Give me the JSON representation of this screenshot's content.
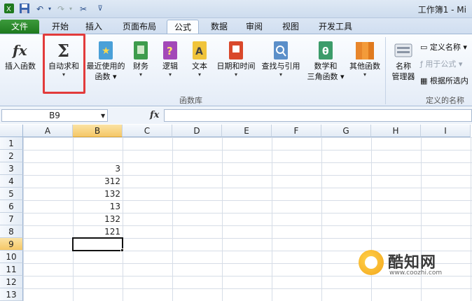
{
  "window": {
    "title": "工作簿1 - Mi"
  },
  "tabs": {
    "file": "文件",
    "items": [
      "开始",
      "插入",
      "页面布局",
      "公式",
      "数据",
      "审阅",
      "视图",
      "开发工具"
    ],
    "active": "公式"
  },
  "ribbon": {
    "insert_function": "插入函数",
    "autosum": "自动求和",
    "recent_1": "最近使用的",
    "recent_2": "函数",
    "financial": "财务",
    "logical": "逻辑",
    "text": "文本",
    "datetime": "日期和时间",
    "lookup": "查找与引用",
    "math_1": "数学和",
    "math_2": "三角函数",
    "more": "其他函数",
    "group_library": "函数库",
    "name_manager_1": "名称",
    "name_manager_2": "管理器",
    "define_name": "定义名称",
    "use_in_formula": "用于公式",
    "create_from_selection": "根据所选内",
    "group_names": "定义的名称"
  },
  "formula_bar": {
    "name_box": "B9",
    "fx": "fx",
    "value": ""
  },
  "grid": {
    "columns": [
      "A",
      "B",
      "C",
      "D",
      "E",
      "F",
      "G",
      "H",
      "I"
    ],
    "rows": [
      "1",
      "2",
      "3",
      "4",
      "5",
      "6",
      "7",
      "8",
      "9",
      "10",
      "11",
      "12",
      "13"
    ],
    "b_values": {
      "3": "3",
      "4": "312",
      "5": "132",
      "6": "13",
      "7": "132",
      "8": "121"
    },
    "selected_cell": "B9"
  },
  "watermark": {
    "name": "酷知网",
    "url": "www.coozhi.com"
  }
}
